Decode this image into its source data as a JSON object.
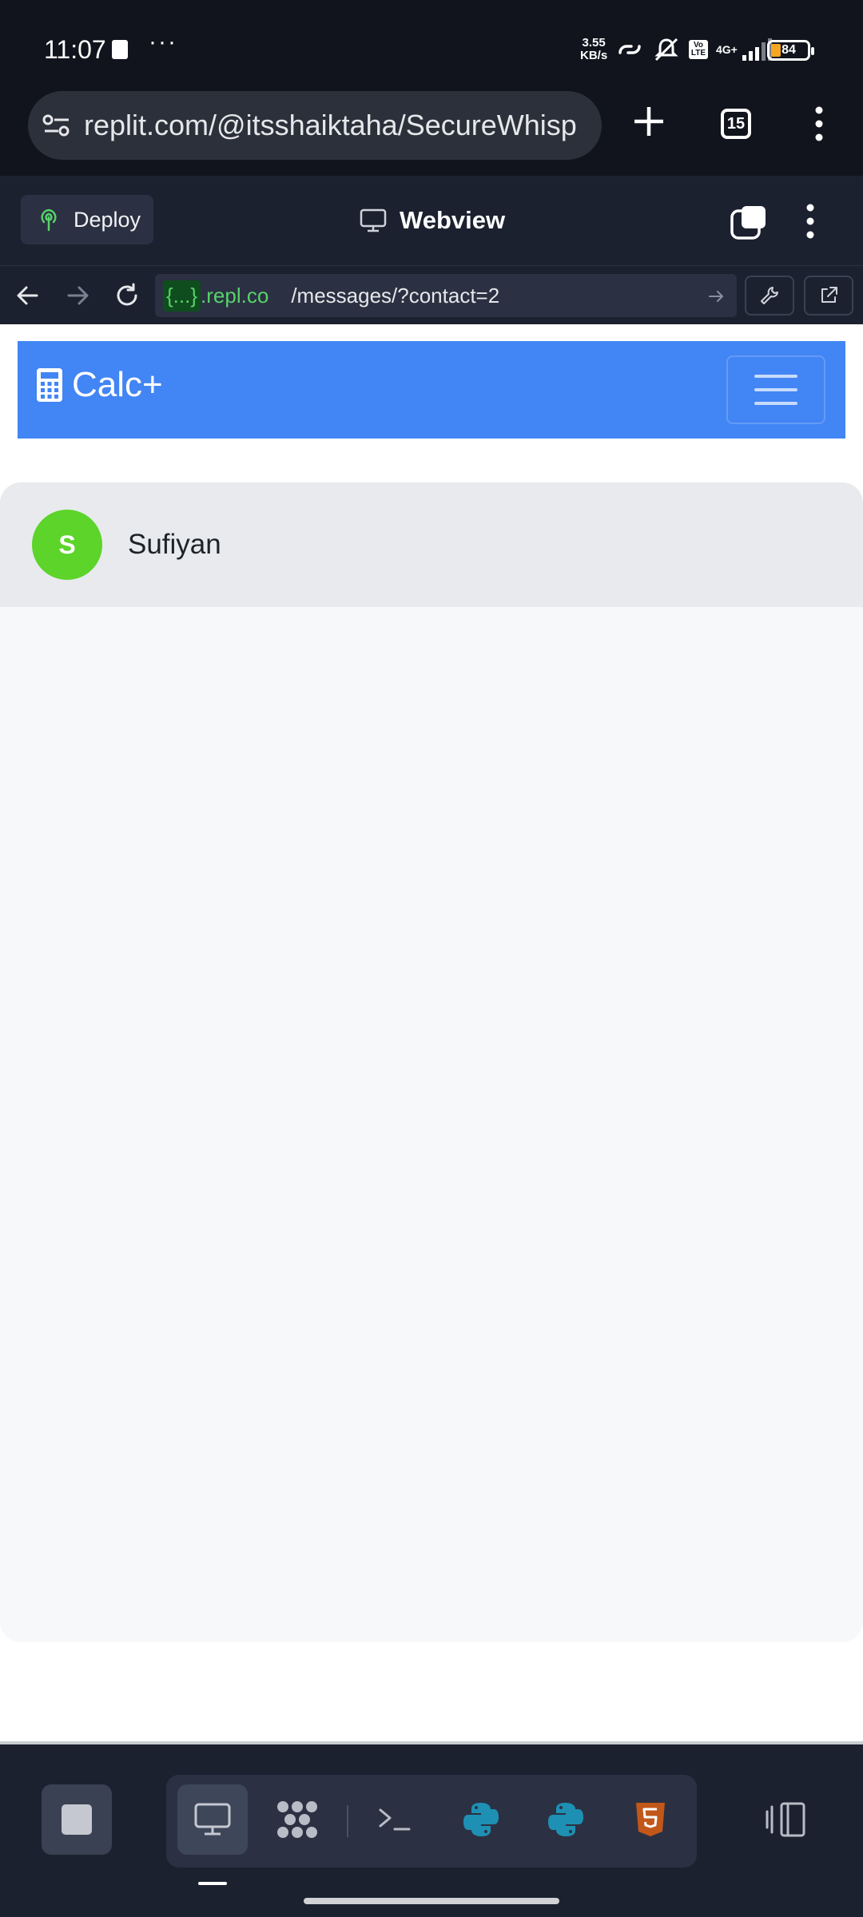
{
  "status_bar": {
    "time": "11:07",
    "dots": "···",
    "net_speed_value": "3.55",
    "net_speed_unit": "KB/s",
    "network_type": "4G+",
    "volte": "Vo LTE",
    "battery": "84"
  },
  "browser": {
    "url": "replit.com/@itsshaiktaha/SecureWhisp",
    "tab_count": "15"
  },
  "replit_header": {
    "deploy_label": "Deploy",
    "title": "Webview"
  },
  "replit_urlbar": {
    "tag": "{...}",
    "domain": ".repl.co",
    "path": "/messages/?contact=2"
  },
  "app": {
    "brand": "Calc+",
    "accent_color": "#4285f4"
  },
  "chat": {
    "contact_initial": "S",
    "contact_name": "Sufiyan",
    "avatar_color": "#5cd42a"
  },
  "dock": {
    "items": [
      "webview-icon",
      "packages-icon",
      "shell-icon",
      "python-icon",
      "python-icon",
      "html5-icon"
    ]
  }
}
